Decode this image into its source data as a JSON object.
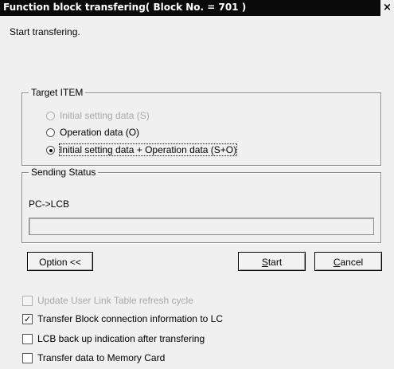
{
  "window": {
    "title": "Function block transfering( Block No. = 701 )",
    "close_glyph": "×"
  },
  "status_message": "Start transfering.",
  "target_item": {
    "legend": "Target ITEM",
    "selected_index": 2,
    "options": [
      {
        "label": "Initial setting data (S)",
        "enabled": false
      },
      {
        "label": "Operation data (O)",
        "enabled": true
      },
      {
        "label": "Initial setting data + Operation data (S+O)",
        "enabled": true
      }
    ]
  },
  "sending_status": {
    "legend": "Sending Status",
    "target": "PC->LCB",
    "progress_percent": 0
  },
  "buttons": {
    "option": "Option <<",
    "start": "Start",
    "start_mnemonic": "S",
    "cancel": "Cancel",
    "cancel_mnemonic": "C"
  },
  "options": [
    {
      "label": "Update User Link Table refresh cycle",
      "checked": false,
      "enabled": false
    },
    {
      "label": "Transfer Block connection information to LC",
      "checked": true,
      "enabled": true
    },
    {
      "label": "LCB back up indication after transfering",
      "checked": false,
      "enabled": true
    },
    {
      "label": "Transfer data to Memory Card",
      "checked": false,
      "enabled": true
    }
  ],
  "colors": {
    "titlebar_bg": "#0a0a0a",
    "dialog_bg": "#f0f0f0",
    "disabled_text": "#a8a8a8",
    "progress_fill": "#1a3a8a"
  },
  "icons": {
    "close": "close-icon",
    "check": "checkmark-icon"
  }
}
